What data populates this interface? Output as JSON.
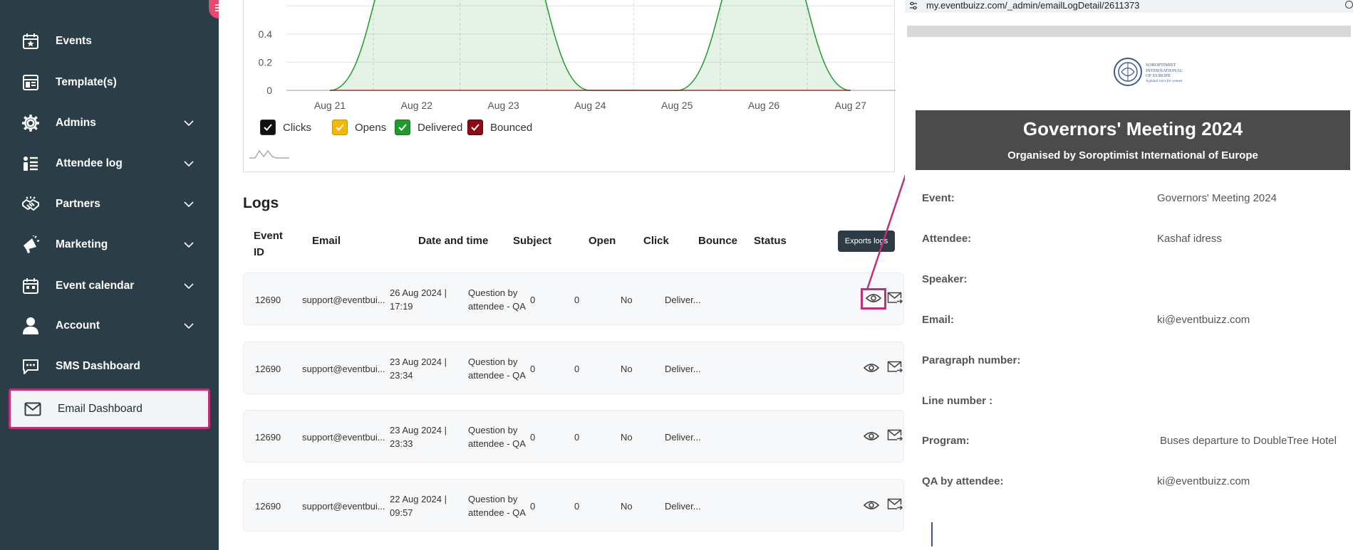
{
  "sidebar": {
    "items": [
      {
        "label": "Events",
        "icon": "calendar-star-icon"
      },
      {
        "label": "Template(s)",
        "icon": "template-icon"
      },
      {
        "label": "Admins",
        "icon": "gear-icon"
      },
      {
        "label": "Attendee log",
        "icon": "list-icon"
      },
      {
        "label": "Partners",
        "icon": "handshake-icon"
      },
      {
        "label": "Marketing",
        "icon": "megaphone-icon"
      },
      {
        "label": "Event calendar",
        "icon": "calendar-icon"
      },
      {
        "label": "Account",
        "icon": "user-icon"
      },
      {
        "label": "SMS Dashboard",
        "icon": "message-icon"
      },
      {
        "label": "Email Dashboard",
        "icon": "mail-icon"
      }
    ]
  },
  "chart_data": {
    "type": "area",
    "categories": [
      "Aug 21",
      "Aug 22",
      "Aug 23",
      "Aug 24",
      "Aug 25",
      "Aug 26",
      "Aug 27"
    ],
    "y_ticks": [
      "0.4",
      "0.2",
      "0"
    ],
    "series": [
      {
        "name": "Clicks",
        "values": [
          0,
          0,
          0,
          0,
          0,
          0,
          0
        ]
      },
      {
        "name": "Opens",
        "values": [
          0,
          0,
          0,
          0,
          0,
          0,
          0
        ]
      },
      {
        "name": "Delivered",
        "values": [
          0,
          1,
          1,
          0,
          0,
          1,
          0
        ]
      },
      {
        "name": "Bounced",
        "values": [
          0,
          0,
          0,
          0,
          0,
          0,
          0
        ]
      }
    ],
    "legend": [
      {
        "label": "Clicks",
        "color": "#111111"
      },
      {
        "label": "Opens",
        "color": "#f5b800"
      },
      {
        "label": "Delivered",
        "color": "#1e9b2a"
      },
      {
        "label": "Bounced",
        "color": "#8b0c14"
      }
    ],
    "grid": true,
    "legend_position": "bottom-left"
  },
  "logs": {
    "title": "Logs",
    "columns": {
      "event_id_1": "Event",
      "event_id_2": "ID",
      "email": "Email",
      "date": "Date and time",
      "subject": "Subject",
      "open": "Open",
      "click": "Click",
      "bounce": "Bounce",
      "status": "Status"
    },
    "tooltip": "Exports logs",
    "rows": [
      {
        "event_id": "12690",
        "email": "support@eventbui...",
        "date_1": "26 Aug 2024 |",
        "date_2": "17:19",
        "subject_1": "Question by",
        "subject_2": "attendee - QA",
        "open": "0",
        "click": "0",
        "bounce": "No",
        "status": "Deliver..."
      },
      {
        "event_id": "12690",
        "email": "support@eventbui...",
        "date_1": "23 Aug 2024 |",
        "date_2": "23:34",
        "subject_1": "Question by",
        "subject_2": "attendee - QA",
        "open": "0",
        "click": "0",
        "bounce": "No",
        "status": "Deliver..."
      },
      {
        "event_id": "12690",
        "email": "support@eventbui...",
        "date_1": "23 Aug 2024 |",
        "date_2": "23:33",
        "subject_1": "Question by",
        "subject_2": "attendee - QA",
        "open": "0",
        "click": "0",
        "bounce": "No",
        "status": "Deliver..."
      },
      {
        "event_id": "12690",
        "email": "support@eventbui...",
        "date_1": "22 Aug 2024 |",
        "date_2": "09:57",
        "subject_1": "Question by",
        "subject_2": "attendee - QA",
        "open": "0",
        "click": "0",
        "bounce": "No",
        "status": "Deliver..."
      }
    ]
  },
  "popup": {
    "url": "my.eventbuizz.com/_admin/emailLogDetail/2611373",
    "logo_lines": [
      "SOROPTIMIST",
      "INTERNATIONAL",
      "OF EUROPE",
      "A global voice for women"
    ],
    "banner_title": "Governors' Meeting 2024",
    "banner_subtitle": "Organised by Soroptimist International of Europe",
    "fields": [
      {
        "label": "Event:",
        "value": "Governors' Meeting 2024"
      },
      {
        "label": "Attendee:",
        "value": "Kashaf idress"
      },
      {
        "label": "Speaker:",
        "value": ""
      },
      {
        "label": "Email:",
        "value": "ki@eventbuizz.com"
      },
      {
        "label": "Paragraph number:",
        "value": ""
      },
      {
        "label": "Line number :",
        "value": ""
      },
      {
        "label": "Program:",
        "value": "Buses departure to DoubleTree Hotel"
      },
      {
        "label": "QA by attendee:",
        "value": "ki@eventbuizz.com"
      }
    ]
  },
  "colors": {
    "sidebar_bg": "#2b3e48",
    "highlight": "#c0307a",
    "toggle": "#e84a6f"
  }
}
